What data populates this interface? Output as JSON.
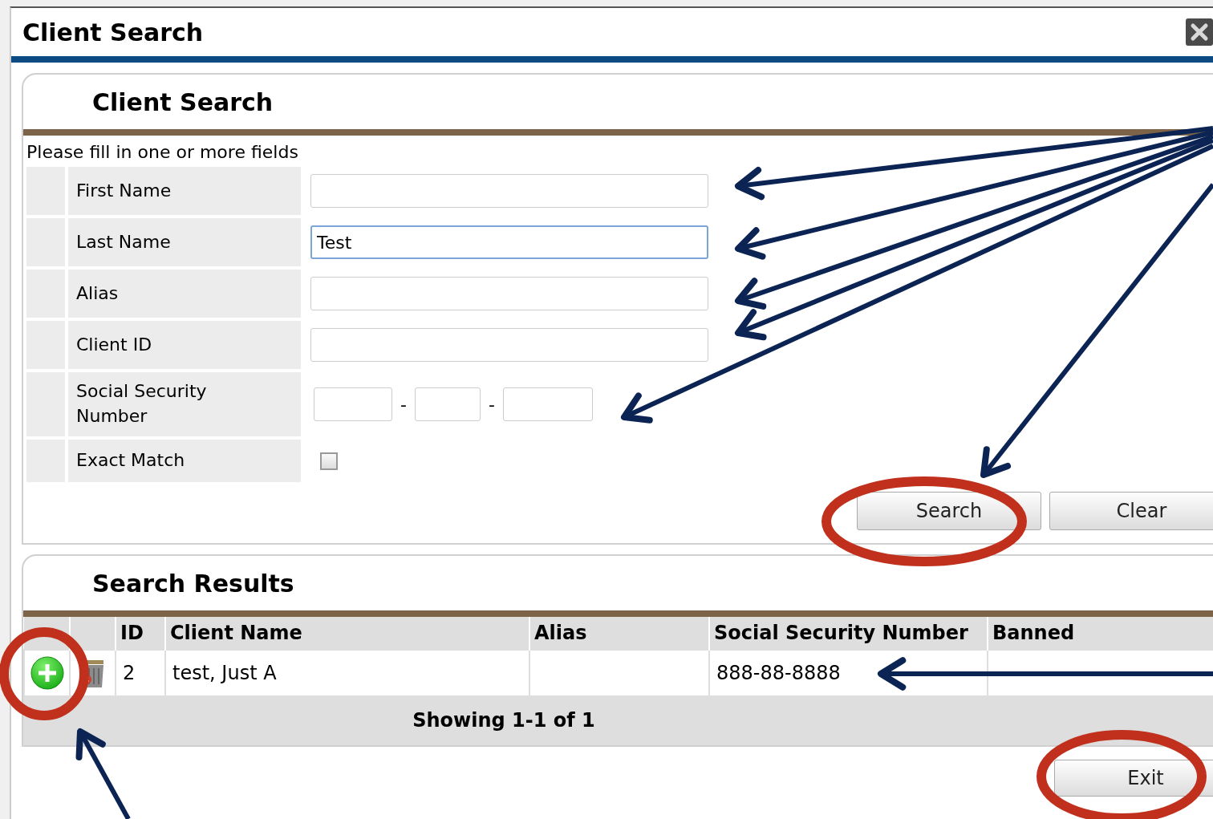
{
  "window": {
    "title": "Client Search"
  },
  "search_panel": {
    "title": "Client Search",
    "instruction": "Please fill in one or more fields",
    "fields": [
      {
        "kind": "text",
        "label": "First Name",
        "focused": false
      },
      {
        "kind": "text",
        "label": "Last Name",
        "value": "Test",
        "focused": true
      },
      {
        "kind": "text",
        "label": "Alias",
        "focused": false
      },
      {
        "kind": "text",
        "label": "Client ID",
        "focused": false
      },
      {
        "kind": "ssn",
        "label": "Social Security Number",
        "separators": [
          "-",
          "-"
        ]
      },
      {
        "kind": "checkbox",
        "label": "Exact Match",
        "checked": false
      }
    ],
    "buttons": [
      "Search",
      "Clear"
    ]
  },
  "results_panel": {
    "title": "Search Results",
    "table": {
      "columns": [
        "ID",
        "Client Name",
        "Alias",
        "Social Security Number",
        "Banned"
      ],
      "rows": [
        {
          "cells": [
            "2",
            "test, Just A",
            null,
            "888-88-8888",
            null
          ]
        }
      ],
      "footer": "Showing 1-1 of 1"
    }
  },
  "buttons": [
    "Exit"
  ]
}
